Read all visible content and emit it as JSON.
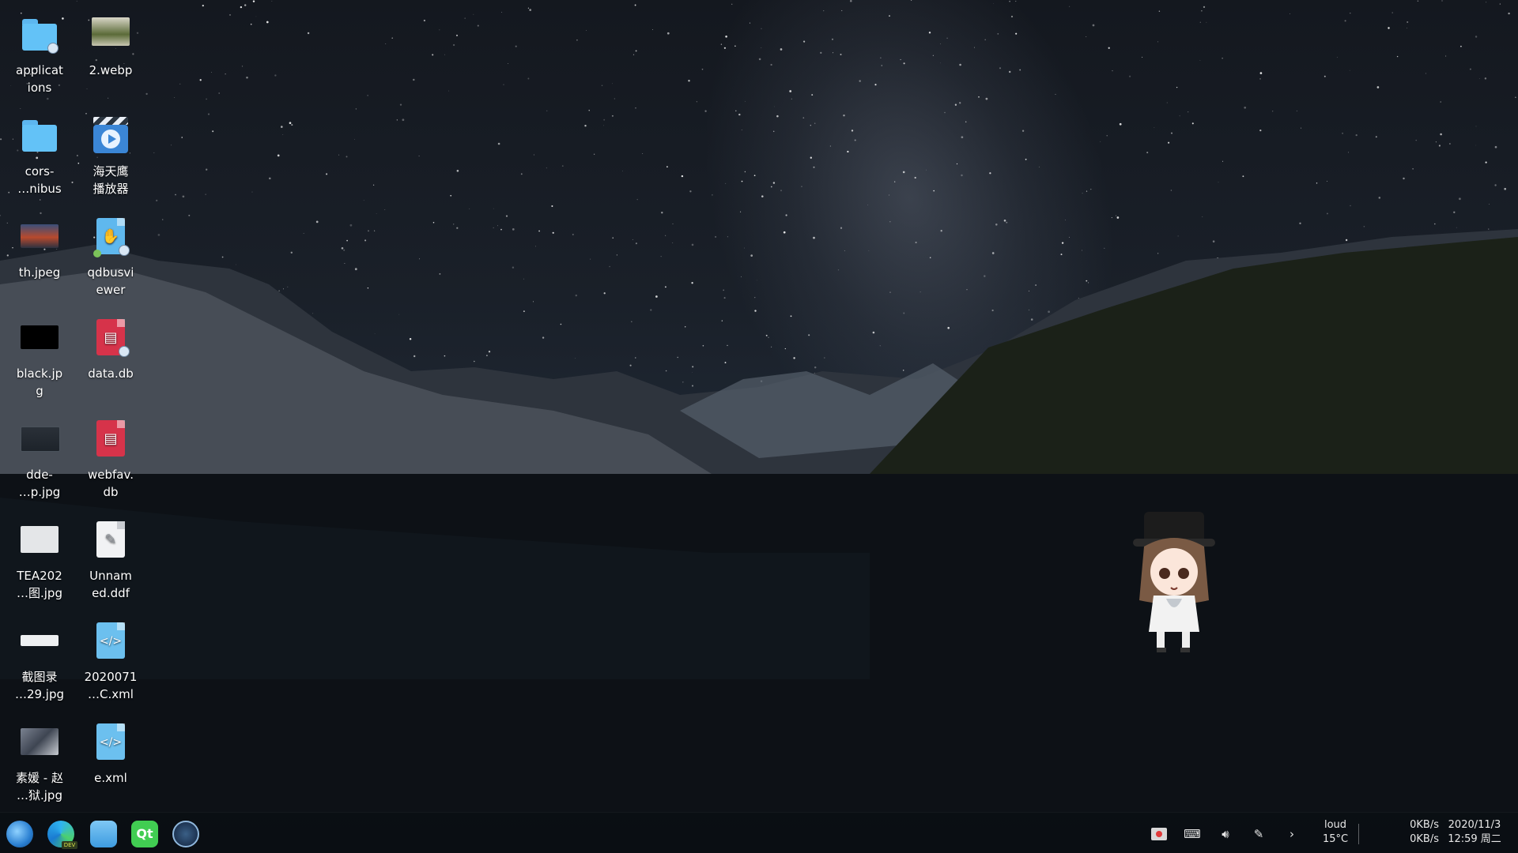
{
  "desktop_icons": [
    {
      "label": "applicat\nions",
      "icon": "folder-icon"
    },
    {
      "label": "cors-\n…nibus",
      "icon": "folder-icon"
    },
    {
      "label": "th.jpeg",
      "icon": "image-thumbnail"
    },
    {
      "label": "black.jp\ng",
      "icon": "image-thumbnail"
    },
    {
      "label": "dde-\n…p.jpg",
      "icon": "image-thumbnail"
    },
    {
      "label": "TEA202\n…图.jpg",
      "icon": "image-thumbnail"
    },
    {
      "label": "截图录\n…29.jpg",
      "icon": "image-thumbnail"
    },
    {
      "label": "素媛 - 赵\n…狱.jpg",
      "icon": "image-thumbnail"
    },
    {
      "label": "2.webp",
      "icon": "image-thumbnail"
    },
    {
      "label": "海天鹰\n播放器",
      "icon": "video-player-icon"
    },
    {
      "label": "qdbusvi\newer",
      "icon": "app-icon"
    },
    {
      "label": "data.db",
      "icon": "database-file-icon"
    },
    {
      "label": "webfav.\ndb",
      "icon": "database-file-icon"
    },
    {
      "label": "Unnam\ned.ddf",
      "icon": "document-file-icon"
    },
    {
      "label": "2020071\n…C.xml",
      "icon": "xml-file-icon"
    },
    {
      "label": "e.xml",
      "icon": "xml-file-icon"
    }
  ],
  "taskbar": {
    "launchers": [
      "deepin-launcher-icon",
      "edge-dev-icon",
      "app-store-icon",
      "qt-creator-icon",
      "system-monitor-icon"
    ],
    "tray": [
      "screen-recorder-icon",
      "keyboard-icon",
      "volume-icon",
      "pen-icon",
      "expand-tray-icon"
    ],
    "chevron": "›",
    "weather_line1": "loud",
    "weather_line2": "15°C",
    "net_up": "0KB/s",
    "net_down": "0KB/s",
    "date": "2020/11/3",
    "time": "12:59 周二"
  },
  "colors": {
    "folder": "#63c2f7",
    "db_red": "#d6334a",
    "xml_blue": "#6cc0ef"
  }
}
